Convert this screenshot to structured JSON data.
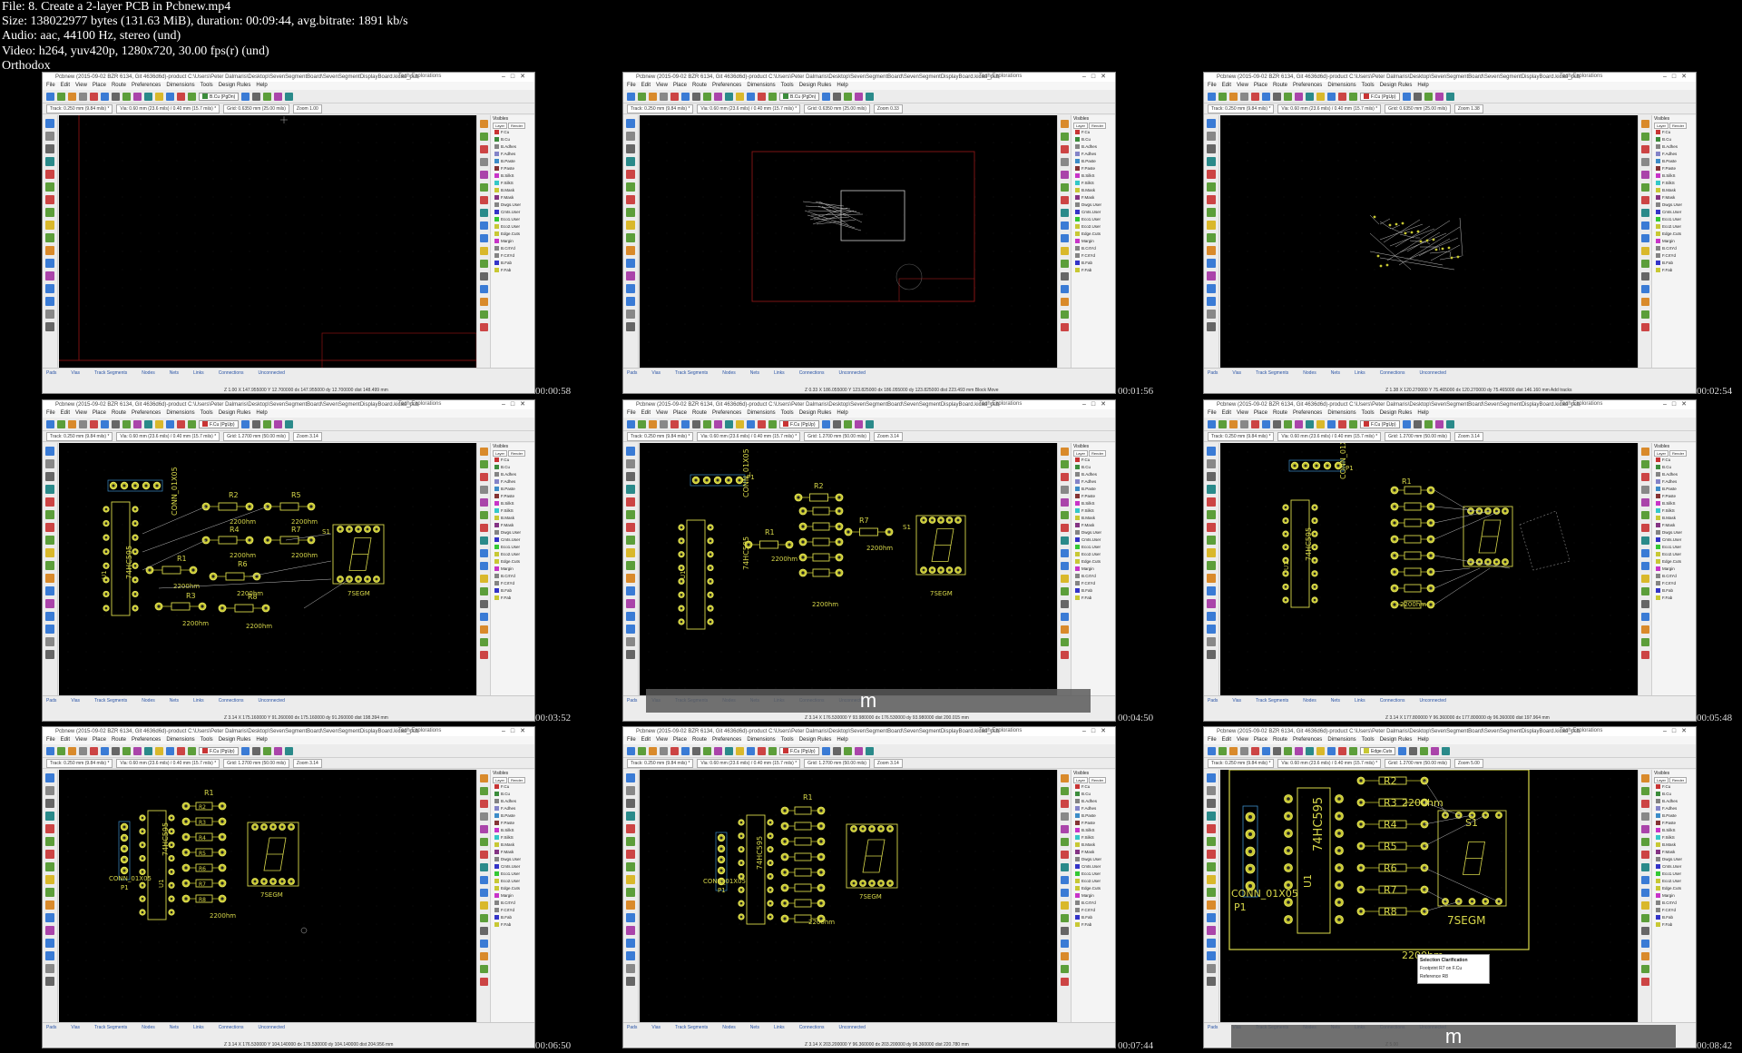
{
  "header": {
    "file": "File: 8. Create a 2-layer PCB in Pcbnew.mp4",
    "size": "Size: 138022977 bytes (131.63 MiB), duration: 00:09:44, avg.bitrate: 1891 kb/s",
    "audio": "Audio: aac, 44100 Hz, stereo (und)",
    "video": "Video: h264, yuv420p, 1280x720, 30.00 fps(r) (und)",
    "author": "Orthodox"
  },
  "app": {
    "title": "Pcbnew (2015-09-02 BZR 6134, Git 4636d6d)-product C:\\Users\\Peter Dalmaris\\Desktop\\SevenSegmentBoard\\SevenSegmentDisplayBoard.kicad_pcb",
    "brand": "Tech Explorations",
    "menu": [
      "File",
      "Edit",
      "View",
      "Place",
      "Route",
      "Preferences",
      "Dimensions",
      "Tools",
      "Design Rules",
      "Help"
    ],
    "track": "Track: 0.250 mm (9.84 mils) *",
    "via": "Via: 0.60 mm (23.6 mils) / 0.40 mm (15.7 mils) *",
    "layers_title": "Visibles",
    "layer_tabs": [
      "Layer",
      "Render"
    ],
    "layers": [
      "F.Cu",
      "B.Cu",
      "B.Adhes",
      "F.Adhes",
      "B.Paste",
      "F.Paste",
      "B.SilkS",
      "F.SilkS",
      "B.Mask",
      "F.Mask",
      "Dwgs.User",
      "Cmts.User",
      "Eco1.User",
      "Eco2.User",
      "Edge.Cuts",
      "Margin",
      "B.CrtYd",
      "F.CrtYd",
      "B.Fab",
      "F.Fab"
    ],
    "layer_colors": [
      "#c83434",
      "#3c8c3c",
      "#848484",
      "#8484c8",
      "#3c8cc8",
      "#843434",
      "#c834c8",
      "#34c8c8",
      "#c8c834",
      "#843484",
      "#848484",
      "#3434c8",
      "#34c834",
      "#c8c834",
      "#c8c834",
      "#c834c8",
      "#848484",
      "#848484",
      "#3434c8",
      "#c8c834"
    ],
    "status_labels": [
      "Pads",
      "Vias",
      "Track Segments",
      "Nodes",
      "Nets",
      "Links",
      "Connections",
      "Unconnected"
    ]
  },
  "tiles": [
    {
      "timestamp": "00:00:58",
      "layer": "B.Cu (PgDn)",
      "grid": "Grid: 0.6350 mm (25.00 mils)",
      "zoom": "Zoom 1.00",
      "coords": "Z 1.00     X 147.955000  Y 12.700000     dx 147.955000  dy 12.700000  dist 148.499     mm"
    },
    {
      "timestamp": "00:01:56",
      "layer": "B.Cu (PgDn)",
      "grid": "Grid: 0.6350 mm (25.00 mils)",
      "zoom": "Zoom 0.33",
      "coords": "Z 0.33     X 186.055000  Y 123.825000     dx 186.055000  dy 123.825000  dist 223.493     mm     Block Move"
    },
    {
      "timestamp": "00:02:54",
      "layer": "F.Cu (PgUp)",
      "grid": "Grid: 0.6350 mm (25.00 mils)",
      "zoom": "Zoom 1.38",
      "coords": "Z 1.38     X 120.270000  Y 75.465000     dx 120.270000  dy 75.465000  dist 146.160     mm     Add tracks"
    },
    {
      "timestamp": "00:03:52",
      "layer": "F.Cu (PgUp)",
      "grid": "Grid: 1.2700 mm (50.00 mils)",
      "zoom": "Zoom 3.14",
      "coords": "Z 3.14     X 175.160000  Y 91.260000     dx 175.160000  dy 91.260000  dist 198.394     mm",
      "footprint": "Pin_Headers:Pin_Header_Straight_1x05",
      "ref": "CONN_01X05"
    },
    {
      "timestamp": "00:04:50",
      "layer": "F.Cu (PgUp)",
      "grid": "Grid: 1.2700 mm (50.00 mils)",
      "zoom": "Zoom 3.14",
      "coords": "Z 3.14     X 176.530000  Y 93.980000     dx 176.530000  dy 93.980000  dist 200.015     mm",
      "footprint": "Resistors_ThroughHole:Resistor_Horizontal_RM10mm",
      "ref": "220Ohm",
      "overlay": "m"
    },
    {
      "timestamp": "00:05:48",
      "layer": "F.Cu (PgUp)",
      "grid": "Grid: 1.2700 mm (50.00 mils)",
      "zoom": "Zoom 3.14",
      "coords": "Z 3.14     X 177.800000  Y 96.360000     dx 177.800000  dy 96.360000  dist 197.964     mm",
      "footprint": "Displays_7-Segment:7SEGM",
      "ref": "7SEGM"
    },
    {
      "timestamp": "00:06:50",
      "layer": "F.Cu (PgUp)",
      "grid": "Grid: 1.2700 mm (50.00 mils)",
      "zoom": "Zoom 3.14",
      "coords": "Z 3.14     X 176.530000  Y 104.140000     dx 176.530000  dy 104.140000  dist 204.956     mm",
      "footprint": "Displays_7-Segment:7SEGM",
      "ref": "7SEGM"
    },
    {
      "timestamp": "00:07:44",
      "layer": "F.Cu (PgUp)",
      "grid": "Grid: 1.2700 mm (50.00 mils)",
      "zoom": "Zoom 3.14",
      "coords": "Z 3.14     X 203.200000  Y 96.360000     dx 203.200000  dy 96.360000  dist 220.780     mm",
      "footprint": "Displays_7-Segment:7SEGM",
      "ref": "7SEGM"
    },
    {
      "timestamp": "00:08:42",
      "layer": "Edge.Cuts",
      "grid": "Grid: 1.2700 mm (50.00 mils)",
      "zoom": "Zoom 5.00",
      "coords": "Z 5.00",
      "overlay": "m",
      "popup": {
        "title": "Selection Clarification",
        "items": [
          "Footprint R7 on F.Cu",
          "Reference R8"
        ]
      }
    }
  ],
  "pcb": {
    "labels_t4": [
      "CONN_01X05",
      "74HC595",
      "R2",
      "R5",
      "R4",
      "R7",
      "R1",
      "R6",
      "R3",
      "R8",
      "2200hm",
      "S1",
      "7SEGM",
      "U1",
      "P1"
    ],
    "labels_t5": [
      "CONN_01X05",
      "P1",
      "R2",
      "R7",
      "R1",
      "S1",
      "7SEGM",
      "74HC595",
      "2200hm",
      "U1"
    ],
    "labels_t6": [
      "CONN_01X05",
      "P1",
      "R1",
      "74HC595",
      "U1",
      "2200hm",
      "7SEGM"
    ],
    "labels_t7": [
      "R1",
      "R2",
      "R3",
      "R4",
      "R5",
      "R6",
      "R7",
      "R8",
      "74HC595",
      "CONN_01X05",
      "P1",
      "U1",
      "7SEGM",
      "2200hm"
    ],
    "labels_t9": [
      "R2",
      "R3",
      "R4",
      "R5",
      "R6",
      "R7",
      "R8",
      "74HC595",
      "CONN_01X05",
      "P1",
      "U1",
      "7SEGM",
      "2200hm",
      "S1"
    ]
  }
}
